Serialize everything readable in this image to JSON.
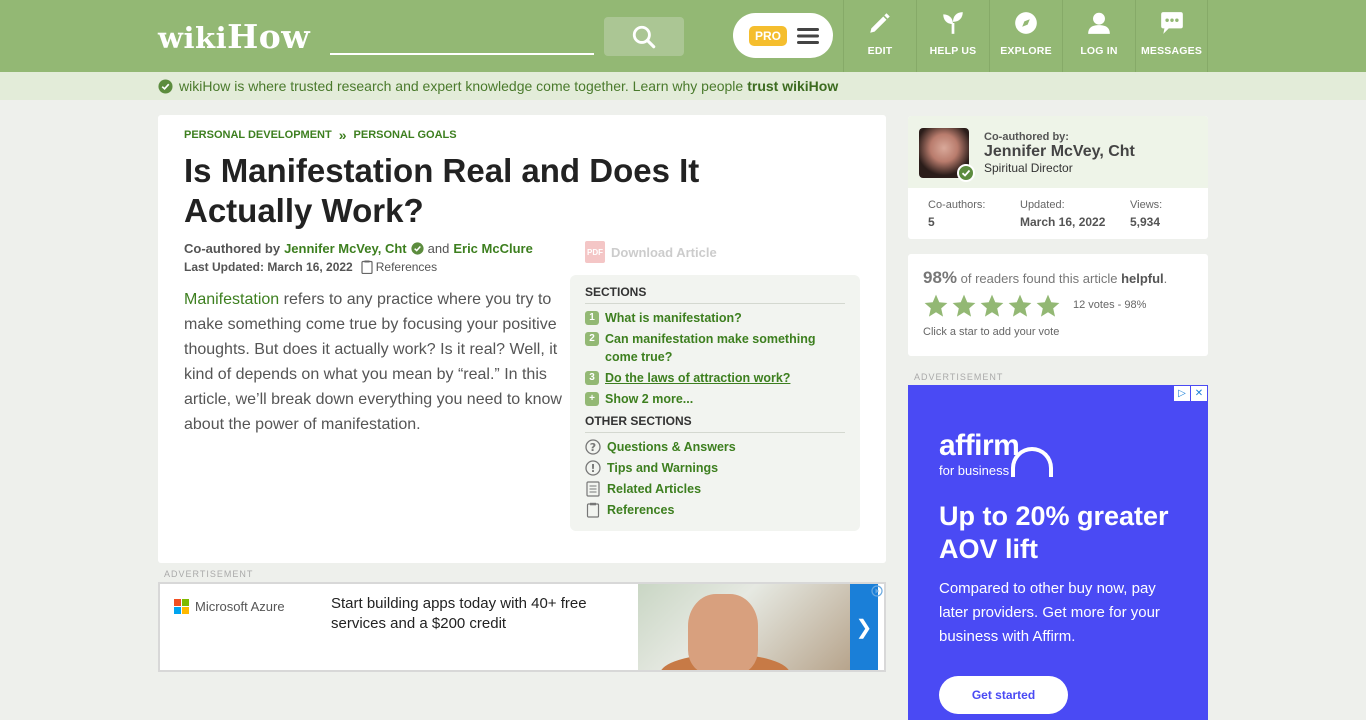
{
  "header": {
    "logo_wiki": "wiki",
    "logo_how": "How",
    "search_placeholder": "",
    "pro_label": "PRO",
    "nav": [
      {
        "label": "EDIT",
        "icon": "pencil-icon"
      },
      {
        "label": "HELP US",
        "icon": "sprout-icon"
      },
      {
        "label": "EXPLORE",
        "icon": "compass-icon"
      },
      {
        "label": "LOG IN",
        "icon": "user-icon"
      },
      {
        "label": "MESSAGES",
        "icon": "chat-icon"
      }
    ]
  },
  "trust_bar": {
    "text": "wikiHow is where trusted research and expert knowledge come together. Learn why people",
    "link": "trust wikiHow"
  },
  "article": {
    "breadcrumb": [
      "PERSONAL DEVELOPMENT",
      "PERSONAL GOALS"
    ],
    "breadcrumb_sep": "»",
    "title": "Is Manifestation Real and Does It Actually Work?",
    "byline_prefix": "Co-authored by",
    "author1": "Jennifer McVey, Cht",
    "byline_and": "and",
    "author2": "Eric McClure",
    "last_updated": "Last Updated: March 16, 2022",
    "references_label": "References",
    "download_label": "Download Article",
    "pdf_label": "PDF",
    "intro_link": "Manifestation",
    "intro_text": " refers to any practice where you try to make something come true by focusing your positive thoughts. But does it actually work? Is it real? Well, it kind of depends on what you mean by “real.” In this article, we’ll break down everything you need to know about the power of manifestation."
  },
  "toc": {
    "sections_heading": "SECTIONS",
    "sections": [
      {
        "num": "1",
        "label": "What is manifestation?"
      },
      {
        "num": "2",
        "label": "Can manifestation make something come true?"
      },
      {
        "num": "3",
        "label": "Do the laws of attraction work?"
      },
      {
        "num": "+",
        "label": "Show 2 more..."
      }
    ],
    "other_heading": "OTHER SECTIONS",
    "other": [
      {
        "label": "Questions & Answers",
        "icon": "question-circle-icon"
      },
      {
        "label": "Tips and Warnings",
        "icon": "exclamation-circle-icon"
      },
      {
        "label": "Related Articles",
        "icon": "document-icon"
      },
      {
        "label": "References",
        "icon": "clipboard-icon"
      }
    ]
  },
  "ad_bottom": {
    "label": "ADVERTISEMENT",
    "brand": "Microsoft Azure",
    "text": "Start building apps today with 40+ free services and a $200 credit",
    "arrow": "❯"
  },
  "sidebar": {
    "coauthor_label": "Co-authored by:",
    "coauthor_name": "Jennifer McVey, Cht",
    "coauthor_role": "Spiritual Director",
    "stats": [
      {
        "label": "Co-authors:",
        "value": "5"
      },
      {
        "label": "Updated:",
        "value": "March 16, 2022"
      },
      {
        "label": "Views:",
        "value": "5,934"
      }
    ],
    "helpful_pct": "98%",
    "helpful_text": " of readers found this article ",
    "helpful_bold": "helpful",
    "helpful_end": ".",
    "stars_filled": 5,
    "votes": "12 votes - 98%",
    "vote_hint": "Click a star to add your vote"
  },
  "ad_side": {
    "label": "ADVERTISEMENT",
    "brand": "affirm",
    "brand_sub": "for business",
    "headline": "Up to 20% greater AOV lift",
    "body": "Compared to other buy now, pay later providers. Get more for your business with Affirm.",
    "cta": "Get started"
  },
  "colors": {
    "header": "#93b874",
    "link_green": "#3d7f1f",
    "affirm_blue": "#4a4af4"
  }
}
